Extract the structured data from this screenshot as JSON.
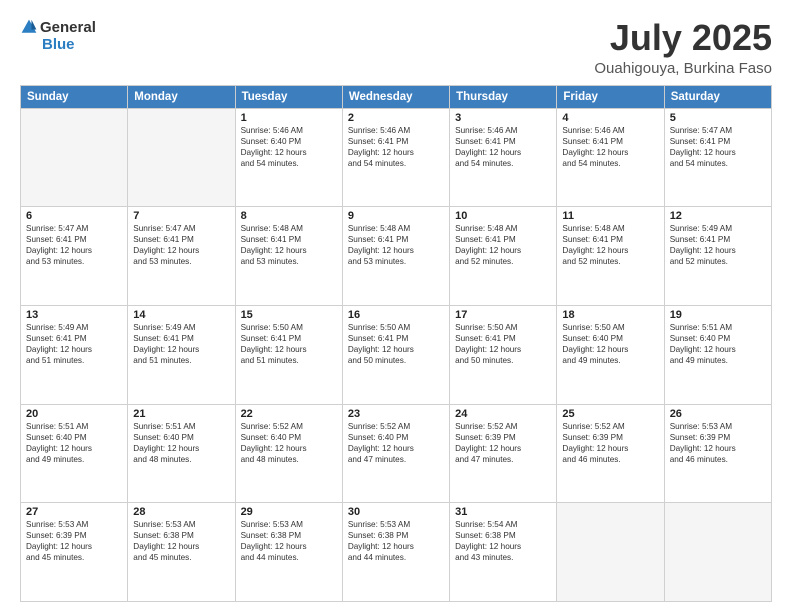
{
  "header": {
    "logo_general": "General",
    "logo_blue": "Blue",
    "month": "July 2025",
    "location": "Ouahigouya, Burkina Faso"
  },
  "weekdays": [
    "Sunday",
    "Monday",
    "Tuesday",
    "Wednesday",
    "Thursday",
    "Friday",
    "Saturday"
  ],
  "weeks": [
    [
      {
        "day": "",
        "info": ""
      },
      {
        "day": "",
        "info": ""
      },
      {
        "day": "1",
        "info": "Sunrise: 5:46 AM\nSunset: 6:40 PM\nDaylight: 12 hours\nand 54 minutes."
      },
      {
        "day": "2",
        "info": "Sunrise: 5:46 AM\nSunset: 6:41 PM\nDaylight: 12 hours\nand 54 minutes."
      },
      {
        "day": "3",
        "info": "Sunrise: 5:46 AM\nSunset: 6:41 PM\nDaylight: 12 hours\nand 54 minutes."
      },
      {
        "day": "4",
        "info": "Sunrise: 5:46 AM\nSunset: 6:41 PM\nDaylight: 12 hours\nand 54 minutes."
      },
      {
        "day": "5",
        "info": "Sunrise: 5:47 AM\nSunset: 6:41 PM\nDaylight: 12 hours\nand 54 minutes."
      }
    ],
    [
      {
        "day": "6",
        "info": "Sunrise: 5:47 AM\nSunset: 6:41 PM\nDaylight: 12 hours\nand 53 minutes."
      },
      {
        "day": "7",
        "info": "Sunrise: 5:47 AM\nSunset: 6:41 PM\nDaylight: 12 hours\nand 53 minutes."
      },
      {
        "day": "8",
        "info": "Sunrise: 5:48 AM\nSunset: 6:41 PM\nDaylight: 12 hours\nand 53 minutes."
      },
      {
        "day": "9",
        "info": "Sunrise: 5:48 AM\nSunset: 6:41 PM\nDaylight: 12 hours\nand 53 minutes."
      },
      {
        "day": "10",
        "info": "Sunrise: 5:48 AM\nSunset: 6:41 PM\nDaylight: 12 hours\nand 52 minutes."
      },
      {
        "day": "11",
        "info": "Sunrise: 5:48 AM\nSunset: 6:41 PM\nDaylight: 12 hours\nand 52 minutes."
      },
      {
        "day": "12",
        "info": "Sunrise: 5:49 AM\nSunset: 6:41 PM\nDaylight: 12 hours\nand 52 minutes."
      }
    ],
    [
      {
        "day": "13",
        "info": "Sunrise: 5:49 AM\nSunset: 6:41 PM\nDaylight: 12 hours\nand 51 minutes."
      },
      {
        "day": "14",
        "info": "Sunrise: 5:49 AM\nSunset: 6:41 PM\nDaylight: 12 hours\nand 51 minutes."
      },
      {
        "day": "15",
        "info": "Sunrise: 5:50 AM\nSunset: 6:41 PM\nDaylight: 12 hours\nand 51 minutes."
      },
      {
        "day": "16",
        "info": "Sunrise: 5:50 AM\nSunset: 6:41 PM\nDaylight: 12 hours\nand 50 minutes."
      },
      {
        "day": "17",
        "info": "Sunrise: 5:50 AM\nSunset: 6:41 PM\nDaylight: 12 hours\nand 50 minutes."
      },
      {
        "day": "18",
        "info": "Sunrise: 5:50 AM\nSunset: 6:40 PM\nDaylight: 12 hours\nand 49 minutes."
      },
      {
        "day": "19",
        "info": "Sunrise: 5:51 AM\nSunset: 6:40 PM\nDaylight: 12 hours\nand 49 minutes."
      }
    ],
    [
      {
        "day": "20",
        "info": "Sunrise: 5:51 AM\nSunset: 6:40 PM\nDaylight: 12 hours\nand 49 minutes."
      },
      {
        "day": "21",
        "info": "Sunrise: 5:51 AM\nSunset: 6:40 PM\nDaylight: 12 hours\nand 48 minutes."
      },
      {
        "day": "22",
        "info": "Sunrise: 5:52 AM\nSunset: 6:40 PM\nDaylight: 12 hours\nand 48 minutes."
      },
      {
        "day": "23",
        "info": "Sunrise: 5:52 AM\nSunset: 6:40 PM\nDaylight: 12 hours\nand 47 minutes."
      },
      {
        "day": "24",
        "info": "Sunrise: 5:52 AM\nSunset: 6:39 PM\nDaylight: 12 hours\nand 47 minutes."
      },
      {
        "day": "25",
        "info": "Sunrise: 5:52 AM\nSunset: 6:39 PM\nDaylight: 12 hours\nand 46 minutes."
      },
      {
        "day": "26",
        "info": "Sunrise: 5:53 AM\nSunset: 6:39 PM\nDaylight: 12 hours\nand 46 minutes."
      }
    ],
    [
      {
        "day": "27",
        "info": "Sunrise: 5:53 AM\nSunset: 6:39 PM\nDaylight: 12 hours\nand 45 minutes."
      },
      {
        "day": "28",
        "info": "Sunrise: 5:53 AM\nSunset: 6:38 PM\nDaylight: 12 hours\nand 45 minutes."
      },
      {
        "day": "29",
        "info": "Sunrise: 5:53 AM\nSunset: 6:38 PM\nDaylight: 12 hours\nand 44 minutes."
      },
      {
        "day": "30",
        "info": "Sunrise: 5:53 AM\nSunset: 6:38 PM\nDaylight: 12 hours\nand 44 minutes."
      },
      {
        "day": "31",
        "info": "Sunrise: 5:54 AM\nSunset: 6:38 PM\nDaylight: 12 hours\nand 43 minutes."
      },
      {
        "day": "",
        "info": ""
      },
      {
        "day": "",
        "info": ""
      }
    ]
  ]
}
